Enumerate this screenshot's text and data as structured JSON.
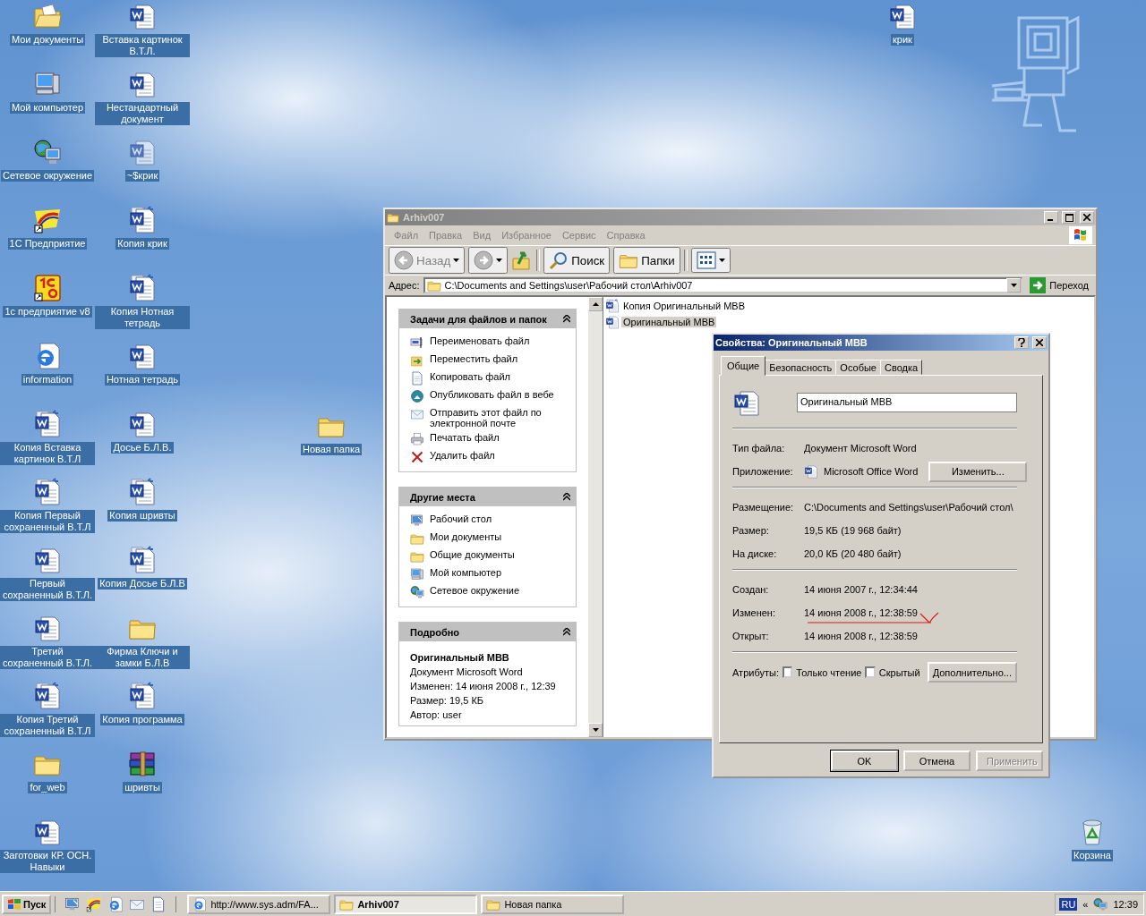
{
  "desktop": {
    "columns": [
      [
        {
          "label": "Мои документы",
          "kind": "folder-open"
        },
        {
          "label": "Мой компьютер",
          "kind": "computer"
        },
        {
          "label": "Сетевое окружение",
          "kind": "network"
        },
        {
          "label": "1С Предприятие",
          "kind": "app1c"
        },
        {
          "label": "1с предприятие v8",
          "kind": "app1c8"
        },
        {
          "label": "information",
          "kind": "ie"
        },
        {
          "label": "Копия Вставка картинок В.Т.Л",
          "kind": "word-copy"
        },
        {
          "label": "Копия Первый сохраненный В.Т.Л",
          "kind": "word-copy"
        },
        {
          "label": "Первый сохраненный В.Т.Л.",
          "kind": "word"
        },
        {
          "label": "Третий сохраненный В.Т.Л.",
          "kind": "word"
        },
        {
          "label": "Копия Третий сохраненный В.Т.Л",
          "kind": "word-copy"
        },
        {
          "label": "for_web",
          "kind": "folder"
        },
        {
          "label": "Заготовки КР. ОСН. Навыки",
          "kind": "word"
        }
      ],
      [
        {
          "label": "Вставка картинок В.Т.Л.",
          "kind": "word"
        },
        {
          "label": "Нестандартный документ",
          "kind": "word"
        },
        {
          "label": "~$крик",
          "kind": "word-hidden"
        },
        {
          "label": "Копия крик",
          "kind": "word-copy"
        },
        {
          "label": "Копия Нотная тетрадь",
          "kind": "word-copy"
        },
        {
          "label": "Нотная тетрадь",
          "kind": "word"
        },
        {
          "label": "Досье Б.Л.В.",
          "kind": "word"
        },
        {
          "label": "Копия шривты",
          "kind": "word-copy"
        },
        {
          "label": "Копия Досье Б.Л.В",
          "kind": "word-copy"
        },
        {
          "label": "Фирма Ключи и замки Б.Л.В",
          "kind": "folder"
        },
        {
          "label": "Копия программа",
          "kind": "word-copy"
        },
        {
          "label": "шривты",
          "kind": "archive"
        }
      ]
    ],
    "other_icons": [
      {
        "label": "Новая папка",
        "kind": "folder"
      },
      {
        "label": "крик",
        "kind": "word"
      },
      {
        "label": "Корзина",
        "kind": "recycle"
      }
    ]
  },
  "explorer": {
    "title": "Arhiv007",
    "menu": [
      "Файл",
      "Правка",
      "Вид",
      "Избранное",
      "Сервис",
      "Справка"
    ],
    "toolbar": {
      "back": "Назад",
      "search": "Поиск",
      "folders": "Папки"
    },
    "address": {
      "label": "Адрес:",
      "value": "C:\\Documents and Settings\\user\\Рабочий стол\\Arhiv007",
      "go": "Переход"
    },
    "panels": [
      {
        "title": "Задачи для файлов и папок",
        "items": [
          {
            "label": "Переименовать файл",
            "kind": "rename"
          },
          {
            "label": "Переместить файл",
            "kind": "move"
          },
          {
            "label": "Копировать файл",
            "kind": "copy"
          },
          {
            "label": "Опубликовать файл в вебе",
            "kind": "publish"
          },
          {
            "label": "Отправить этот файл по электронной почте",
            "kind": "email"
          },
          {
            "label": "Печатать файл",
            "kind": "print"
          },
          {
            "label": "Удалить файл",
            "kind": "delete"
          }
        ]
      },
      {
        "title": "Другие места",
        "items": [
          {
            "label": "Рабочий стол",
            "kind": "desktop"
          },
          {
            "label": "Мои документы",
            "kind": "mydocs"
          },
          {
            "label": "Общие документы",
            "kind": "folder"
          },
          {
            "label": "Мой компьютер",
            "kind": "computer"
          },
          {
            "label": "Сетевое окружение",
            "kind": "network"
          }
        ]
      }
    ],
    "details": {
      "title": "Подробно",
      "name": "Оригинальный МВВ",
      "type": "Документ Microsoft Word",
      "lines": [
        "Изменен: 14 июня 2008 г., 12:39",
        "Размер: 19,5 КБ",
        "Автор: user"
      ]
    },
    "files": [
      {
        "name": "Копия Оригинальный МВВ",
        "kind": "word-copy",
        "selected": false
      },
      {
        "name": "Оригинальный МВВ",
        "kind": "word",
        "selected": true
      }
    ]
  },
  "dialog": {
    "title": "Свойства: Оригинальный МВВ",
    "tabs": [
      {
        "label": "Общие",
        "selected": true
      },
      {
        "label": "Безопасность",
        "selected": false
      },
      {
        "label": "Особые",
        "selected": false
      },
      {
        "label": "Сводка",
        "selected": false
      }
    ],
    "file_name": "Оригинальный МВВ",
    "sections": [
      [
        {
          "label": "Тип файла:",
          "value": "Документ Microsoft Word",
          "kind": "text",
          "red_mark": false
        },
        {
          "label": "Приложение:",
          "value": "Microsoft Office Word",
          "kind": "app",
          "button": "Изменить...",
          "red_mark": false
        }
      ],
      [
        {
          "label": "Размещение:",
          "value": "C:\\Documents and Settings\\user\\Рабочий стол\\",
          "kind": "text",
          "red_mark": false
        },
        {
          "label": "Размер:",
          "value": "19,5 КБ (19 968 байт)",
          "kind": "text",
          "red_mark": false
        },
        {
          "label": "На диске:",
          "value": "20,0 КБ (20 480 байт)",
          "kind": "text",
          "red_mark": false
        }
      ],
      [
        {
          "label": "Создан:",
          "value": "14 июня 2007 г., 12:34:44",
          "kind": "text",
          "red_mark": false
        },
        {
          "label": "Изменен:",
          "value": "14 июня 2008 г., 12:38:59",
          "kind": "text",
          "red_mark": true
        },
        {
          "label": "Открыт:",
          "value": "14 июня 2008 г., 12:38:59",
          "kind": "text",
          "red_mark": false
        }
      ]
    ],
    "attributes": {
      "label": "Атрибуты:",
      "checkboxes": [
        {
          "label": "Только чтение",
          "checked": false
        },
        {
          "label": "Скрытый",
          "checked": false
        }
      ],
      "button": "Дополнительно..."
    },
    "buttons": [
      {
        "label": "OK",
        "disabled": false
      },
      {
        "label": "Отмена",
        "disabled": false
      },
      {
        "label": "Применить",
        "disabled": true
      }
    ]
  },
  "taskbar": {
    "start": "Пуск",
    "tasks": [
      {
        "label": "http://www.sys.adm/FA...",
        "kind": "ie",
        "selected": false
      },
      {
        "label": "Arhiv007",
        "kind": "folder",
        "selected": true
      },
      {
        "label": "Новая папка",
        "kind": "folder",
        "selected": false
      }
    ],
    "tray": {
      "language": "RU",
      "expand": "«",
      "clock": "12:39"
    }
  }
}
